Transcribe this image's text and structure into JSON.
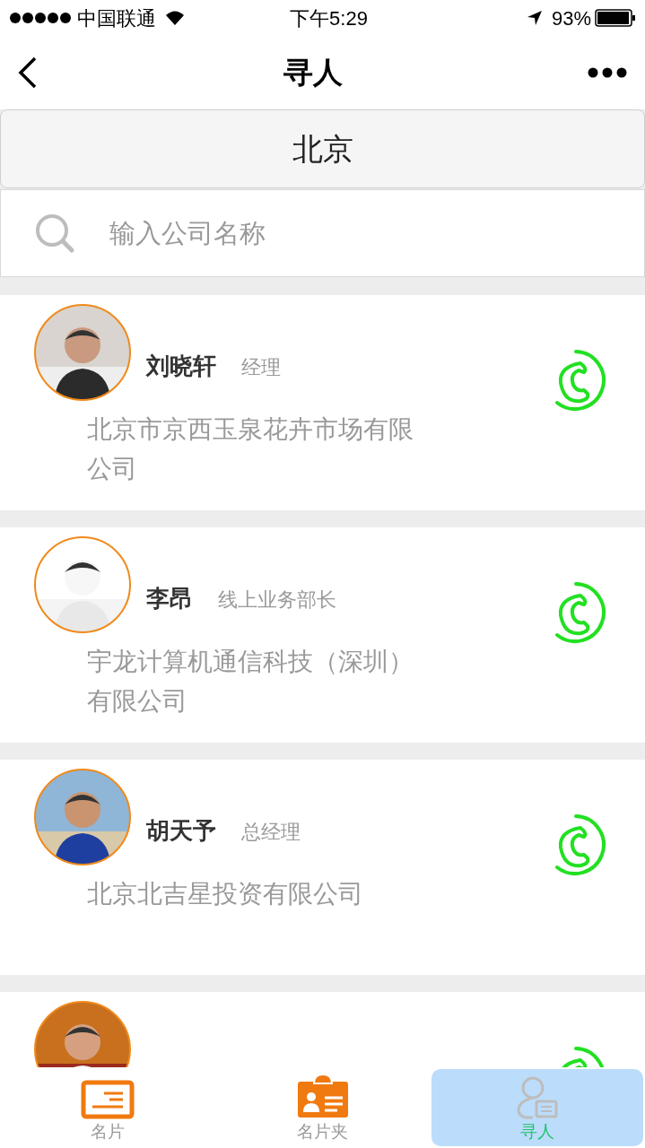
{
  "status_bar": {
    "carrier": "中国联通",
    "time": "下午5:29",
    "battery": "93%"
  },
  "nav": {
    "title": "寻人"
  },
  "city": "北京",
  "search": {
    "placeholder": "输入公司名称"
  },
  "people": [
    {
      "kind": "full",
      "name": "刘晓轩",
      "title": "经理",
      "company": "北京市京西玉泉花卉市场有限公司"
    },
    {
      "kind": "full",
      "name": "李昂",
      "title": "线上业务部长",
      "company": "宇龙计算机通信科技（深圳）有限公司"
    },
    {
      "kind": "full",
      "name": "胡天予",
      "title": "总经理",
      "company": "北京北吉星投资有限公司"
    },
    {
      "kind": "cut_off"
    }
  ],
  "tabs": [
    {
      "label": "名片",
      "kind": "card",
      "selected": false
    },
    {
      "label": "名片夹",
      "kind": "badge",
      "selected": false
    },
    {
      "label": "寻人",
      "kind": "person",
      "selected": true
    }
  ]
}
